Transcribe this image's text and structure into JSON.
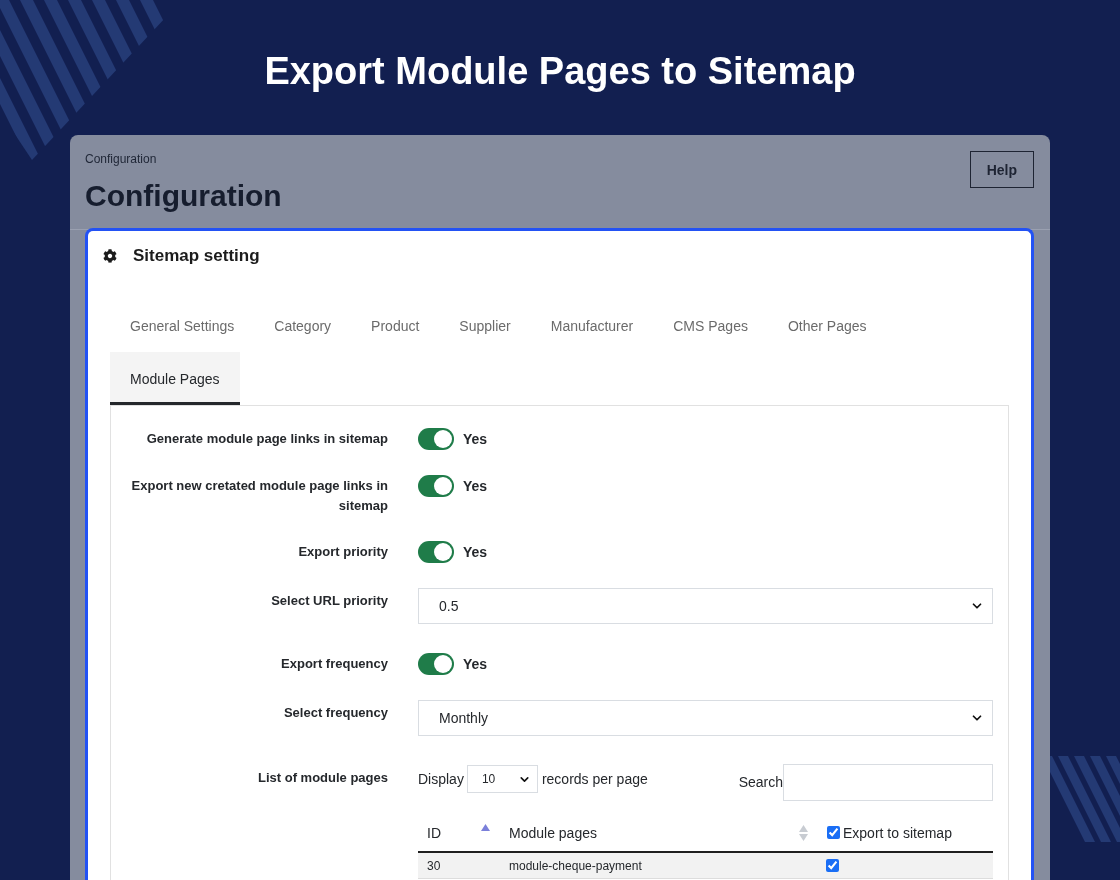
{
  "page_title": "Export Module Pages to Sitemap",
  "header": {
    "breadcrumb": "Configuration",
    "title": "Configuration",
    "help_button": "Help"
  },
  "card": {
    "title": "Sitemap setting",
    "tabs": [
      {
        "label": "General Settings",
        "selected": false
      },
      {
        "label": "Category",
        "selected": false
      },
      {
        "label": "Product",
        "selected": false
      },
      {
        "label": "Supplier",
        "selected": false
      },
      {
        "label": "Manufacturer",
        "selected": false
      },
      {
        "label": "CMS Pages",
        "selected": false
      },
      {
        "label": "Other Pages",
        "selected": false
      },
      {
        "label": "Module Pages",
        "selected": true
      }
    ],
    "fields": [
      {
        "kind": "toggle",
        "label": "Generate module page links in sitemap",
        "on": true,
        "value": "Yes"
      },
      {
        "kind": "toggle",
        "label": "Export new cretated module page links in sitemap",
        "on": true,
        "value": "Yes"
      },
      {
        "kind": "toggle",
        "label": "Export priority",
        "on": true,
        "value": "Yes"
      },
      {
        "kind": "select",
        "label": "Select URL priority",
        "value": "0.5"
      },
      {
        "kind": "toggle",
        "label": "Export frequency",
        "on": true,
        "value": "Yes"
      },
      {
        "kind": "select",
        "label": "Select frequency",
        "value": "Monthly"
      }
    ],
    "module_list": {
      "label": "List of module pages",
      "display_label": "Display",
      "page_size": "10",
      "records_label": "records per page",
      "search_label": "Search",
      "columns": [
        {
          "kind": "sortable",
          "label": "ID",
          "sorted": true
        },
        {
          "kind": "sortable",
          "label": "Module pages",
          "sorted": false
        },
        {
          "kind": "checkbox",
          "label": "Export to sitemap",
          "checked": true
        }
      ],
      "rows": [
        {
          "id": "30",
          "module_page": "module-cheque-payment",
          "checked": true
        }
      ]
    }
  }
}
